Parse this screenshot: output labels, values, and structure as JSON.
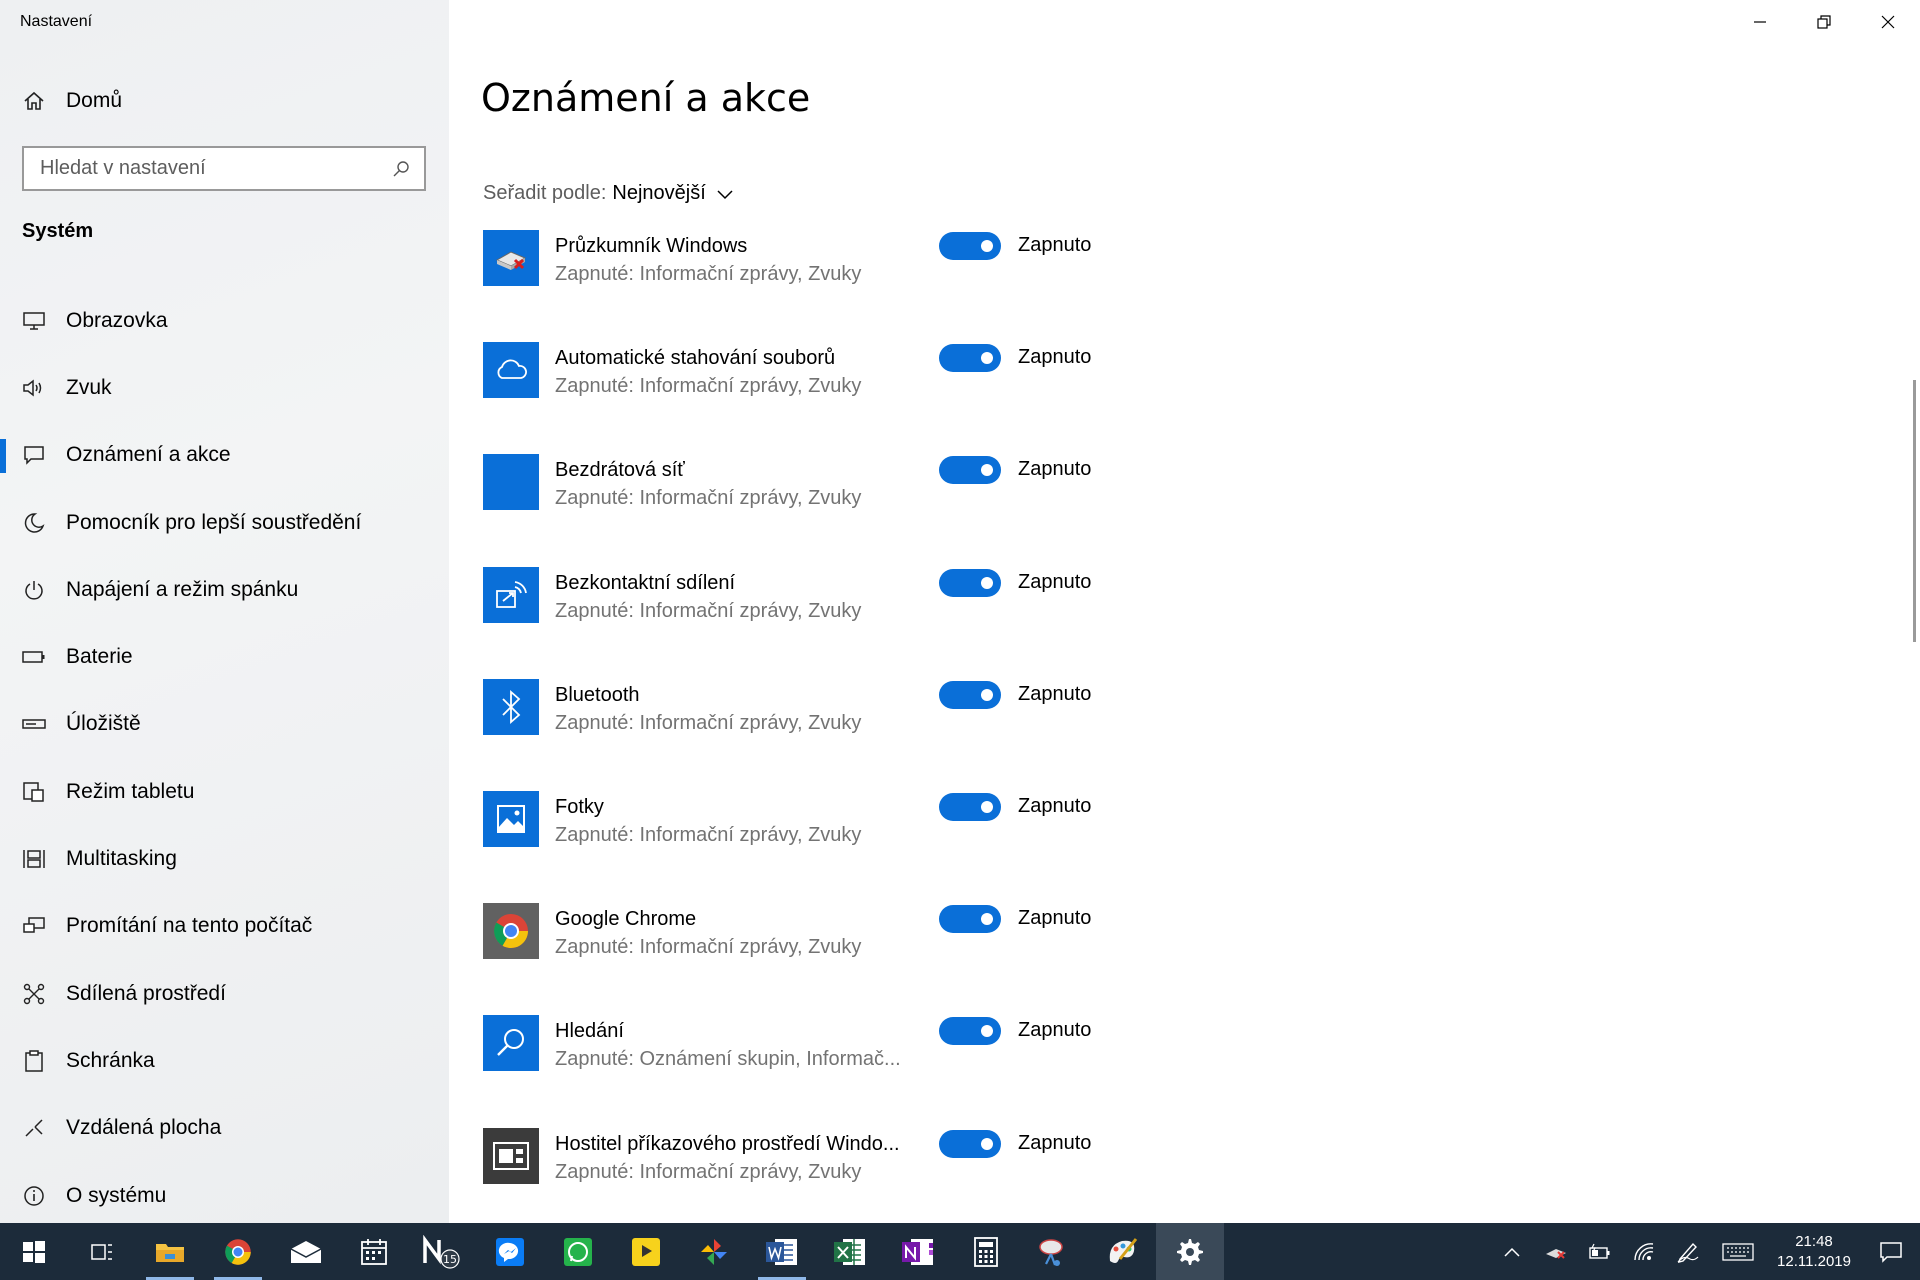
{
  "window": {
    "title": "Nastavení"
  },
  "sidebar": {
    "home_label": "Domů",
    "search_placeholder": "Hledat v nastavení",
    "section_title": "Systém",
    "items": [
      {
        "label": "Obrazovka",
        "icon": "monitor-icon"
      },
      {
        "label": "Zvuk",
        "icon": "speaker-icon"
      },
      {
        "label": "Oznámení a akce",
        "icon": "notification-icon",
        "active": true
      },
      {
        "label": "Pomocník pro lepší soustředění",
        "icon": "moon-icon"
      },
      {
        "label": "Napájení a režim spánku",
        "icon": "power-icon"
      },
      {
        "label": "Baterie",
        "icon": "battery-icon"
      },
      {
        "label": "Úložiště",
        "icon": "storage-icon"
      },
      {
        "label": "Režim tabletu",
        "icon": "tablet-icon"
      },
      {
        "label": "Multitasking",
        "icon": "multitasking-icon"
      },
      {
        "label": "Promítání na tento počítač",
        "icon": "projecting-icon"
      },
      {
        "label": "Sdílená prostředí",
        "icon": "shared-experiences-icon"
      },
      {
        "label": "Schránka",
        "icon": "clipboard-icon"
      },
      {
        "label": "Vzdálená plocha",
        "icon": "remote-desktop-icon"
      },
      {
        "label": "O systému",
        "icon": "info-icon"
      }
    ]
  },
  "main": {
    "page_title": "Oznámení a akce",
    "sort_label": "Seřadit podle:",
    "sort_value": "Nejnovější",
    "apps": [
      {
        "name": "Průzkumník Windows",
        "sub": "Zapnuté: Informační zprávy, Zvuky",
        "toggle": "Zapnuto",
        "icon": "windows-explorer-icon"
      },
      {
        "name": "Automatické stahování souborů",
        "sub": "Zapnuté: Informační zprávy, Zvuky",
        "toggle": "Zapnuto",
        "icon": "cloud-icon"
      },
      {
        "name": "Bezdrátová síť",
        "sub": "Zapnuté: Informační zprávy, Zvuky",
        "toggle": "Zapnuto",
        "icon": "blank-tile-icon"
      },
      {
        "name": "Bezkontaktní sdílení",
        "sub": "Zapnuté: Informační zprávy, Zvuky",
        "toggle": "Zapnuto",
        "icon": "nearby-share-icon"
      },
      {
        "name": "Bluetooth",
        "sub": "Zapnuté: Informační zprávy, Zvuky",
        "toggle": "Zapnuto",
        "icon": "bluetooth-icon"
      },
      {
        "name": "Fotky",
        "sub": "Zapnuté: Informační zprávy, Zvuky",
        "toggle": "Zapnuto",
        "icon": "photos-icon"
      },
      {
        "name": "Google Chrome",
        "sub": "Zapnuté: Informační zprávy, Zvuky",
        "toggle": "Zapnuto",
        "icon": "chrome-icon"
      },
      {
        "name": "Hledání",
        "sub": "Zapnuté: Oznámení skupin, Informač...",
        "toggle": "Zapnuto",
        "icon": "search-icon"
      },
      {
        "name": "Hostitel příkazového prostředí Windo...",
        "sub": "Zapnuté: Informační zprávy, Zvuky",
        "toggle": "Zapnuto",
        "icon": "shell-host-icon"
      }
    ]
  },
  "taskbar": {
    "time": "21:48",
    "date": "12.11.2019",
    "onenote_badge": "15"
  },
  "colors": {
    "accent": "#0a6fd8",
    "taskbar": "#1c2b3a"
  }
}
